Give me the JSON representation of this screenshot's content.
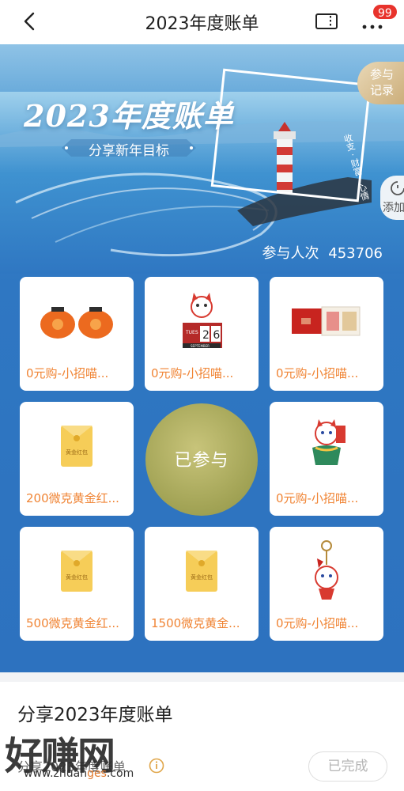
{
  "nav": {
    "title": "2023年度账单",
    "badge": "99",
    "icons": {
      "back": "chevron-left-icon",
      "ticket": "ticket-icon",
      "more": "more-icon"
    }
  },
  "hero": {
    "title": "2023年度账单",
    "subtitle": "分享新年目标",
    "photo_caption": "收支 · 财富 · 心情",
    "records_label_1": "参与",
    "records_label_2": "记录",
    "add_label": "添加",
    "participants_text": "参与人次",
    "participants_count": "453706"
  },
  "grid": {
    "joined_label": "已参与",
    "items": [
      {
        "label": "0元购-小招喵...",
        "icon": "persimmon-pair-icon"
      },
      {
        "label": "0元购-小招喵...",
        "icon": "calendar-cat-icon",
        "calendar_day": "TUES",
        "calendar_date": "2  6",
        "calendar_month": "SEPTEMBER"
      },
      {
        "label": "0元购-小招喵...",
        "icon": "notebook-icon"
      },
      {
        "label": "200微克黄金红...",
        "icon": "gold-envelope-icon",
        "envelope_text": "黄金红包"
      },
      {
        "label": "0元购-小招喵...",
        "icon": "cat-figurine-icon"
      },
      {
        "label": "500微克黄金红...",
        "icon": "gold-envelope-icon",
        "envelope_text": "黄金红包"
      },
      {
        "label": "1500微克黄金...",
        "icon": "gold-envelope-icon",
        "envelope_text": "黄金红包"
      },
      {
        "label": "0元购-小招喵...",
        "icon": "keychain-icon"
      }
    ]
  },
  "task": {
    "title": "分享2023年度账单",
    "desc": "分享2023年度账单",
    "done_label": "已完成"
  },
  "watermark": {
    "big": "好赚网",
    "url_pre": "www.zhuan",
    "url_mid": "ges",
    "url_post": ".com"
  },
  "colors": {
    "accent_orange": "#f08434",
    "badge_red": "#e8332c",
    "hero_blue": "#2f77c2",
    "joined_olive": "#a3a456",
    "gold": "#f2c94c"
  }
}
